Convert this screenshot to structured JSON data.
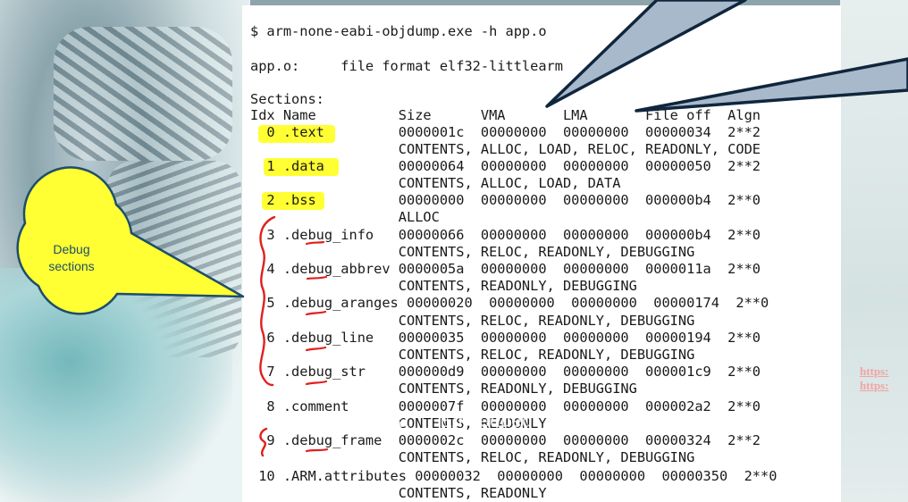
{
  "terminal": {
    "command": "$ arm-none-eabi-objdump.exe -h app.o",
    "file_line": "app.o:     file format elf32-littlearm",
    "sections_heading": "Sections:",
    "header_row": "Idx Name          Size      VMA       LMA       File off  Algn",
    "rows": [
      "  0 .text         0000001c  00000000  00000000  00000034  2**2",
      "                  CONTENTS, ALLOC, LOAD, RELOC, READONLY, CODE",
      "  1 .data         00000064  00000000  00000000  00000050  2**2",
      "                  CONTENTS, ALLOC, LOAD, DATA",
      "  2 .bss          00000000  00000000  00000000  000000b4  2**0",
      "                  ALLOC",
      "  3 .debug_info   00000066  00000000  00000000  000000b4  2**0",
      "                  CONTENTS, RELOC, READONLY, DEBUGGING",
      "  4 .debug_abbrev 0000005a  00000000  00000000  0000011a  2**0",
      "                  CONTENTS, READONLY, DEBUGGING",
      "  5 .debug_aranges 00000020  00000000  00000000  00000174  2**0",
      "                  CONTENTS, RELOC, READONLY, DEBUGGING",
      "  6 .debug_line   00000035  00000000  00000000  00000194  2**0",
      "                  CONTENTS, RELOC, READONLY, DEBUGGING",
      "  7 .debug_str    000000d9  00000000  00000000  000001c9  2**0",
      "                  CONTENTS, READONLY, DEBUGGING",
      "  8 .comment      0000007f  00000000  00000000  000002a2  2**0",
      "                  CONTENTS, READONLY",
      "  9 .debug_frame  0000002c  00000000  00000000  00000324  2**2",
      "                  CONTENTS, RELOC, READONLY, DEBUGGING",
      " 10 .ARM.attributes 00000032  00000000  00000000  00000350  2**0",
      "                  CONTENTS, READONLY"
    ]
  },
  "callout": {
    "text": "Debug sections",
    "fill": "#ffff33",
    "stroke": "#1d4e6b"
  },
  "watermark": {
    "name": "Keroles Shenouda",
    "middle": "Embedded",
    "subtitle": "(Mastering Embedded System online Diploma)"
  },
  "urls": [
    "https:",
    "https:"
  ],
  "colors": {
    "highlight": "#ffff33",
    "annotation_red": "#e0201c",
    "arrow_fill": "#a9b9cc",
    "arrow_stroke": "#10263d"
  }
}
